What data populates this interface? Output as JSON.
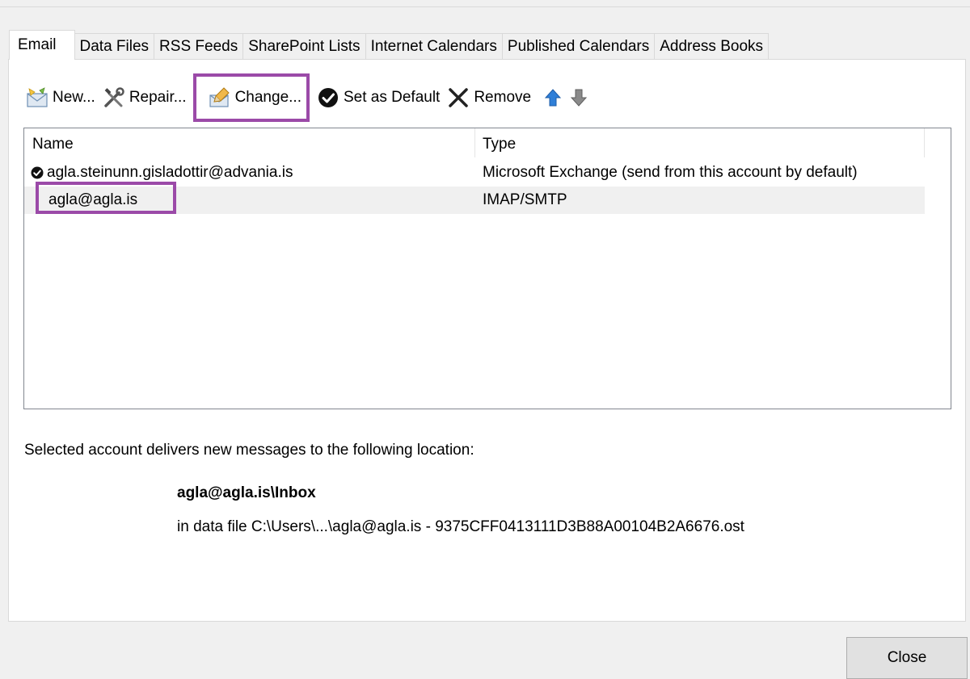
{
  "tabs": [
    {
      "label": "Email",
      "active": true
    },
    {
      "label": "Data Files"
    },
    {
      "label": "RSS Feeds"
    },
    {
      "label": "SharePoint Lists"
    },
    {
      "label": "Internet Calendars"
    },
    {
      "label": "Published Calendars"
    },
    {
      "label": "Address Books"
    }
  ],
  "toolbar": {
    "new_label": "New...",
    "repair_label": "Repair...",
    "change_label": "Change...",
    "set_default_label": "Set as Default",
    "remove_label": "Remove",
    "move_up_icon": "arrow-up-icon",
    "move_down_icon": "arrow-down-icon"
  },
  "accounts": {
    "columns": {
      "name": "Name",
      "type": "Type"
    },
    "rows": [
      {
        "name": "agla.steinunn.gisladottir@advania.is",
        "type": "Microsoft Exchange (send from this account by default)",
        "default": true
      },
      {
        "name": "agla@agla.is",
        "type": "IMAP/SMTP",
        "selected": true
      }
    ]
  },
  "delivery": {
    "label": "Selected account delivers new messages to the following location:",
    "path": "agla@agla.is\\Inbox",
    "file": "in data file C:\\Users\\...\\agla@agla.is - 9375CFF0413111D3B88A00104B2A6676.ost"
  },
  "close_label": "Close",
  "colors": {
    "highlight": "#9b4aa8",
    "selected_row": "#f0f0f0",
    "arrow_up": "#2f7fd8",
    "arrow_down": "#707070"
  }
}
